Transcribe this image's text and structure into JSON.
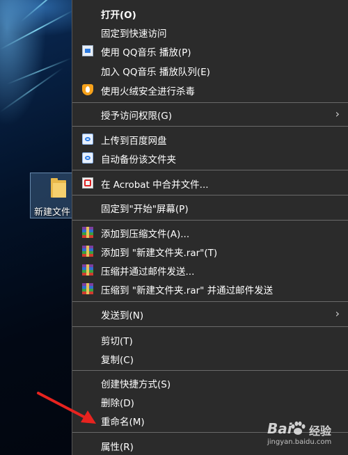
{
  "desktop": {
    "folder_label": "新建文件"
  },
  "menu": {
    "items": [
      {
        "label": "打开(O)",
        "icon": "none"
      },
      {
        "label": "固定到快速访问",
        "icon": "none"
      },
      {
        "label": "使用 QQ音乐 播放(P)",
        "icon": "qq-music-icon"
      },
      {
        "label": "加入 QQ音乐 播放队列(E)",
        "icon": "none"
      },
      {
        "label": "使用火绒安全进行杀毒",
        "icon": "huorong-shield-icon"
      },
      {
        "label": "授予访问权限(G)",
        "icon": "none",
        "submenu": true
      },
      {
        "label": "上传到百度网盘",
        "icon": "baidu-netdisk-icon"
      },
      {
        "label": "自动备份该文件夹",
        "icon": "baidu-netdisk-icon"
      },
      {
        "label": "在 Acrobat 中合并文件...",
        "icon": "acrobat-icon"
      },
      {
        "label": "固定到\"开始\"屏幕(P)",
        "icon": "none"
      },
      {
        "label": "添加到压缩文件(A)...",
        "icon": "winrar-icon"
      },
      {
        "label": "添加到 \"新建文件夹.rar\"(T)",
        "icon": "winrar-icon"
      },
      {
        "label": "压缩并通过邮件发送...",
        "icon": "winrar-icon"
      },
      {
        "label": "压缩到 \"新建文件夹.rar\" 并通过邮件发送",
        "icon": "winrar-icon"
      },
      {
        "label": "发送到(N)",
        "icon": "none",
        "submenu": true
      },
      {
        "label": "剪切(T)",
        "icon": "none"
      },
      {
        "label": "复制(C)",
        "icon": "none"
      },
      {
        "label": "创建快捷方式(S)",
        "icon": "none"
      },
      {
        "label": "删除(D)",
        "icon": "none"
      },
      {
        "label": "重命名(M)",
        "icon": "none"
      },
      {
        "label": "属性(R)",
        "icon": "none"
      }
    ],
    "submenu_glyph": "›"
  },
  "watermark": {
    "logo": "Bai",
    "brand": "经验",
    "url": "jingyan.baidu.com"
  },
  "colors": {
    "menu_bg": "#2b2b2b",
    "separator": "#6a6a6a",
    "text": "#ffffff",
    "annotation_arrow": "#e8231f"
  }
}
